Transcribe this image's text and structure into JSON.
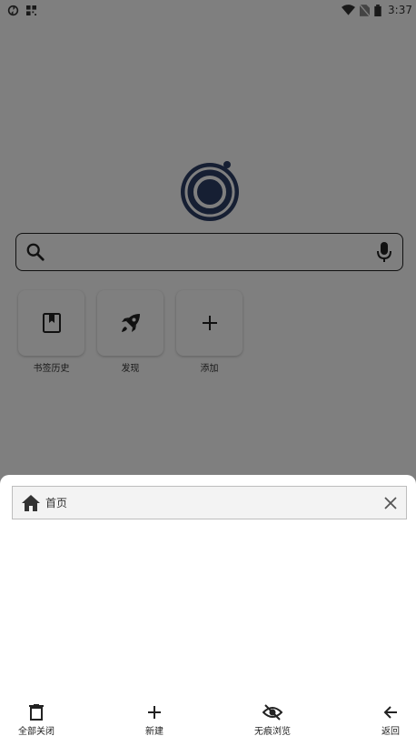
{
  "status_bar": {
    "time": "3:37",
    "left_icons": [
      "sync-icon",
      "qr-icon"
    ],
    "right_icons": [
      "wifi-icon",
      "no-sim-icon",
      "battery-icon"
    ]
  },
  "home": {
    "search": {
      "placeholder": ""
    },
    "shortcuts": [
      {
        "label": "书签历史",
        "icon": "bookmark-icon"
      },
      {
        "label": "发现",
        "icon": "rocket-icon"
      },
      {
        "label": "添加",
        "icon": "plus-icon"
      }
    ]
  },
  "sheet": {
    "tabs": [
      {
        "title": "首页",
        "icon": "home-icon"
      }
    ],
    "toolbar": {
      "close_all": "全部关闭",
      "new_tab": "新建",
      "incognito": "无痕浏览",
      "back": "返回"
    }
  },
  "colors": {
    "overlay": "#000000",
    "sheet_bg": "#ffffff",
    "tab_bg": "#f3f3f3",
    "icon": "#222222"
  }
}
